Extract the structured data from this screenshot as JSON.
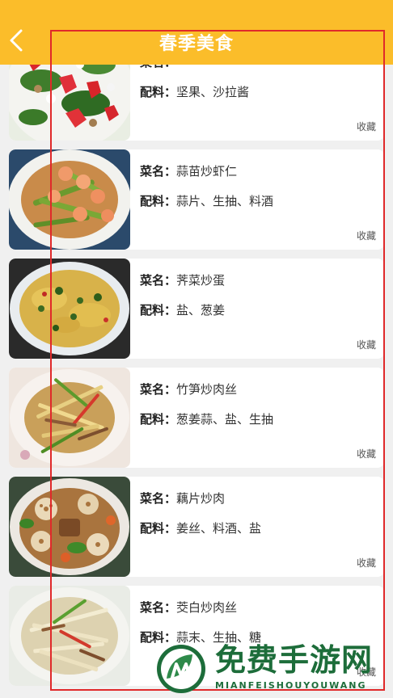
{
  "header": {
    "title": "春季美食",
    "back_icon": "chevron-left-icon"
  },
  "labels": {
    "name": "菜名：",
    "ingredients": "配料：",
    "favorite": "收藏"
  },
  "items": [
    {
      "name": "",
      "ingredients": "坚果、沙拉酱",
      "image": "strawberry-spinach-salad-photo"
    },
    {
      "name": "蒜苗炒虾仁",
      "ingredients": "蒜片、生抽、料酒",
      "image": "garlic-sprout-shrimp-photo"
    },
    {
      "name": "荠菜炒蛋",
      "ingredients": "盐、葱姜",
      "image": "shepherds-purse-egg-photo"
    },
    {
      "name": "竹笋炒肉丝",
      "ingredients": "葱姜蒜、盐、生抽",
      "image": "bamboo-shoot-pork-photo"
    },
    {
      "name": "藕片炒肉",
      "ingredients": "姜丝、料酒、盐",
      "image": "lotus-root-pork-photo"
    },
    {
      "name": "茭白炒肉丝",
      "ingredients": "蒜末、生抽、糖",
      "image": "water-bamboo-pork-photo"
    }
  ],
  "watermark": {
    "title": "免费手游网",
    "subtitle": "MIANFEISHOUYOUWANG",
    "logo": "m-leaf-logo"
  },
  "colors": {
    "header_bg": "#fbbd2a",
    "page_bg": "#f0f0f0",
    "highlight_frame": "#e0292a",
    "watermark": "#1d6d3a"
  }
}
